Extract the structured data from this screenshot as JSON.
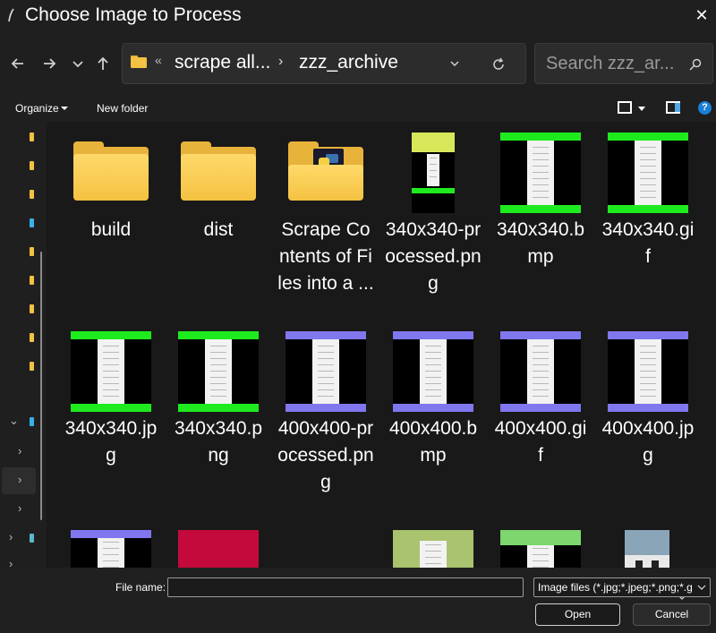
{
  "window": {
    "title": "Choose Image to Process"
  },
  "nav": {
    "breadcrumb": [
      "scrape all...",
      "zzz_archive"
    ],
    "search_placeholder": "Search zzz_ar..."
  },
  "commands": {
    "organize": "Organize",
    "new_folder": "New folder"
  },
  "items": [
    {
      "label": "build",
      "kind": "folder"
    },
    {
      "label": "dist",
      "kind": "folder"
    },
    {
      "label": "Scrape Contents of Files into a ...",
      "kind": "folder-python"
    },
    {
      "label": "340x340-processed.png",
      "kind": "image",
      "band": "#d8e75a"
    },
    {
      "label": "340x340.bmp",
      "kind": "image",
      "band": "#1eeb1e"
    },
    {
      "label": "340x340.gif",
      "kind": "image",
      "band": "#1eeb1e"
    },
    {
      "label": "340x340.jpg",
      "kind": "image",
      "band": "#1eeb1e"
    },
    {
      "label": "340x340.png",
      "kind": "image",
      "band": "#1eeb1e"
    },
    {
      "label": "400x400-processed.png",
      "kind": "image",
      "band": "#8077ee"
    },
    {
      "label": "400x400.bmp",
      "kind": "image",
      "band": "#8077ee"
    },
    {
      "label": "400x400.gif",
      "kind": "image",
      "band": "#8077ee"
    },
    {
      "label": "400x400.jpg",
      "kind": "image",
      "band": "#8077ee"
    }
  ],
  "footer": {
    "file_name_label": "File name:",
    "file_name_value": "",
    "file_type": "Image files (*.jpg;*.jpeg;*.png;*.g",
    "open": "Open",
    "cancel": "Cancel"
  },
  "colors": {
    "folder": "#f4c242",
    "accent": "#1a7fd6",
    "bg": "#191919",
    "partial_red": "#c4093d",
    "partial_olive": "#a9c36e",
    "partial_slate": "#8aa4b8"
  }
}
